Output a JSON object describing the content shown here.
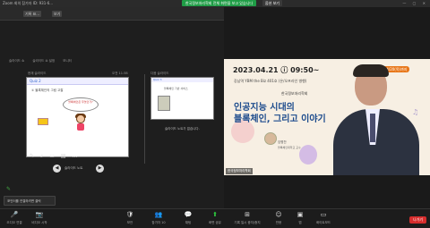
{
  "titlebar": {
    "app_title": "Zoom 회의 참가자 ID: 931-6...",
    "share_banner": "한국정보처리학회 전체 화면을 보고 있습니다",
    "share_options": "옵션 보기",
    "window_controls": "— ▢ ✕"
  },
  "app_panel": {
    "top_chips": [
      "기록 표...",
      "보기"
    ],
    "tiny_toolbar": [
      "슬라이드 쇼",
      "슬라이드 쇼 설정",
      "모니터"
    ],
    "current_label": "현재 슬라이드",
    "timer": "오전 11:38",
    "next_label": "다음 슬라이드",
    "main_slide": {
      "header": "Quiz 2",
      "subtitle": "① 블록체인의 그림 고찰",
      "bubble": "블록체인은 무엇인가?"
    },
    "next_slide": {
      "header": "Quiz 3",
      "text": "블록체인 기반 서비스"
    },
    "tools": [
      "✎",
      "⌕",
      "▭",
      "▤",
      "…"
    ],
    "prev_icon": "◀",
    "next_icon": "▶",
    "note_label": "슬라이드 노트",
    "next_note": "슬라이드 노트가 없습니다.",
    "hint": "포인터를 연결하려면 클릭",
    "pen_icon": "✎"
  },
  "video": {
    "date": "2023.04.21 ⓘ 09:50~",
    "badge": "마감일 4/20(목)까지",
    "venue": "강남역 YBM the Biz 401호 (온/오프라인 병행)",
    "org": "한국정보처리학회",
    "title1": "인공지능 시대의",
    "title2": "블록체인, 그리고 이야기",
    "speaker_name": "임병찬",
    "speaker_sub": "블록체인대학교 교수",
    "name_tag": "한국정보처리학회",
    "music_icon": "♫"
  },
  "toolbar": {
    "buttons": [
      {
        "icon": "🎤",
        "label": "오디오 연결"
      },
      {
        "icon": "📷",
        "label": "비디오 시작"
      },
      {
        "icon": "🛡",
        "label": "보안"
      },
      {
        "icon": "👥",
        "label": "참가자 10"
      },
      {
        "icon": "💬",
        "label": "채팅"
      },
      {
        "icon": "⬆",
        "label": "화면 공유"
      },
      {
        "icon": "⊞",
        "label": "기록 일시 중지/중지"
      },
      {
        "icon": "☺",
        "label": "반응"
      },
      {
        "icon": "▣",
        "label": "앱"
      },
      {
        "icon": "▭",
        "label": "화이트보드"
      }
    ],
    "leave": "나가기"
  }
}
